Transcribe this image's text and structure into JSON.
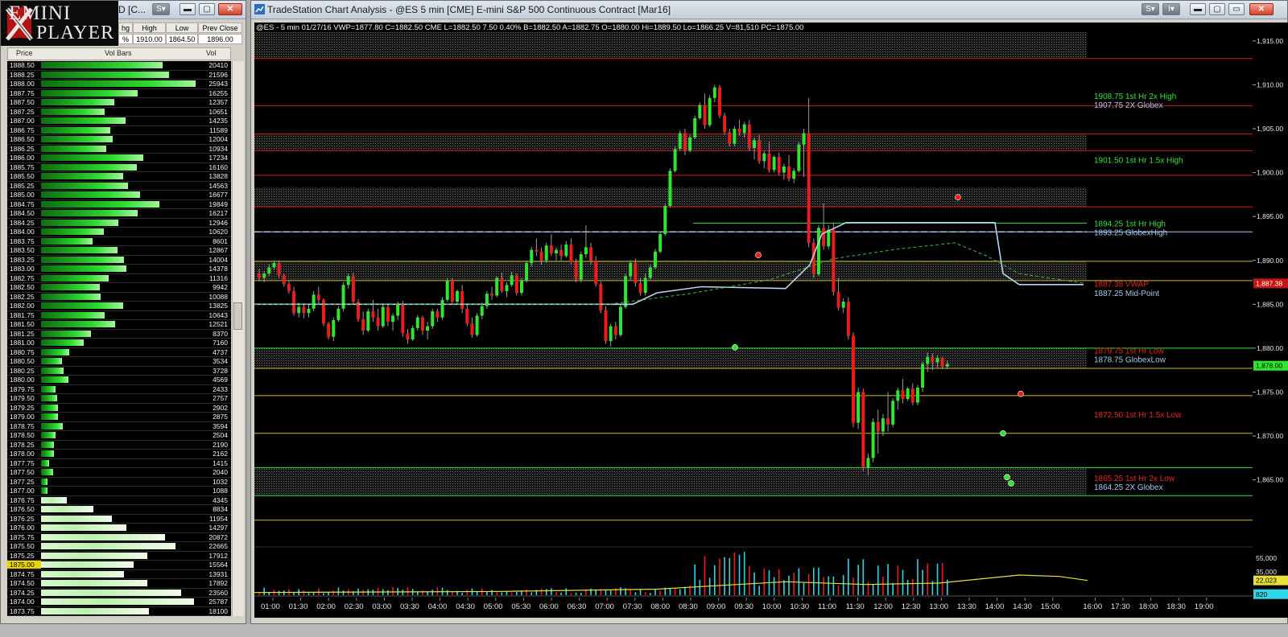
{
  "ladder_window": {
    "title": "D [C...",
    "logo_line1": "EMINI",
    "logo_line2": "PLAYER",
    "quote_headers": [
      "hg",
      "High",
      "Low",
      "Prev Close"
    ],
    "quote_values": [
      "%",
      "1910.00",
      "1864.50",
      "1896.00"
    ],
    "col_price": "Price",
    "col_volbars": "Vol Bars",
    "col_vol": "Vol",
    "current_price": "1875.00",
    "rows": [
      [
        "1888.50",
        "20410"
      ],
      [
        "1888.25",
        "21596"
      ],
      [
        "1888.00",
        "25943"
      ],
      [
        "1887.75",
        "16255"
      ],
      [
        "1887.50",
        "12357"
      ],
      [
        "1887.25",
        "10651"
      ],
      [
        "1887.00",
        "14235"
      ],
      [
        "1886.75",
        "11589"
      ],
      [
        "1886.50",
        "12004"
      ],
      [
        "1886.25",
        "10934"
      ],
      [
        "1886.00",
        "17234"
      ],
      [
        "1885.75",
        "16160"
      ],
      [
        "1885.50",
        "13828"
      ],
      [
        "1885.25",
        "14563"
      ],
      [
        "1885.00",
        "16677"
      ],
      [
        "1884.75",
        "19849"
      ],
      [
        "1884.50",
        "16217"
      ],
      [
        "1884.25",
        "12946"
      ],
      [
        "1884.00",
        "10620"
      ],
      [
        "1883.75",
        "8601"
      ],
      [
        "1883.50",
        "12867"
      ],
      [
        "1883.25",
        "14004"
      ],
      [
        "1883.00",
        "14378"
      ],
      [
        "1882.75",
        "11316"
      ],
      [
        "1882.50",
        "9942"
      ],
      [
        "1882.25",
        "10088"
      ],
      [
        "1882.00",
        "13825"
      ],
      [
        "1881.75",
        "10643"
      ],
      [
        "1881.50",
        "12521"
      ],
      [
        "1881.25",
        "8370"
      ],
      [
        "1881.00",
        "7160"
      ],
      [
        "1880.75",
        "4737"
      ],
      [
        "1880.50",
        "3534"
      ],
      [
        "1880.25",
        "3728"
      ],
      [
        "1880.00",
        "4569"
      ],
      [
        "1879.75",
        "2433"
      ],
      [
        "1879.50",
        "2757"
      ],
      [
        "1879.25",
        "2902"
      ],
      [
        "1879.00",
        "2875"
      ],
      [
        "1878.75",
        "3594"
      ],
      [
        "1878.50",
        "2504"
      ],
      [
        "1878.25",
        "2190"
      ],
      [
        "1878.00",
        "2162"
      ],
      [
        "1877.75",
        "1415"
      ],
      [
        "1877.50",
        "2040"
      ],
      [
        "1877.25",
        "1032"
      ],
      [
        "1877.00",
        "1088"
      ],
      [
        "1876.75",
        "4345"
      ],
      [
        "1876.50",
        "8834"
      ],
      [
        "1876.25",
        "11954"
      ],
      [
        "1876.00",
        "14297"
      ],
      [
        "1875.75",
        "20872"
      ],
      [
        "1875.50",
        "22665"
      ],
      [
        "1875.25",
        "17912"
      ],
      [
        "1875.00",
        "15564"
      ],
      [
        "1874.75",
        "13931"
      ],
      [
        "1874.50",
        "17892"
      ],
      [
        "1874.25",
        "23560"
      ],
      [
        "1874.00",
        "25787"
      ],
      [
        "1873.75",
        "18100"
      ]
    ]
  },
  "chart_window": {
    "title": "TradeStation Chart Analysis - @ES 5 min [CME] E-mini S&P 500 Continuous Contract [Mar16]",
    "infobar": "@ES - 5 min  01/27/16  VWP=1877.80  C=1882.50  CME  L=1882.50  7.50  0.40%  B=1882.50  A=1882.75  O=1880.00  Hi=1889.50  Lo=1866.25  V=81,510  PC=1875.00",
    "last_price_tag": "1,878.00",
    "vwap_tag": "1,887.38",
    "vol_tag_ma": "22,023",
    "vol_tag_last": "820",
    "level_labels": [
      {
        "text": "1908.75 1st Hr  2x High",
        "color": "#37e23c"
      },
      {
        "text": "1907.75 2X Globex",
        "color": "#a9c8ee"
      },
      {
        "text": "1901.50 1st Hr  1.5x High",
        "color": "#37e23c"
      },
      {
        "text": "1894.25 1st Hr  High",
        "color": "#37e23c"
      },
      {
        "text": "1893.25 GlobexHigh",
        "color": "#a9c8ee"
      },
      {
        "text": "1887.38 VWAP",
        "color": "#e8251c"
      },
      {
        "text": "1887.25 Mid-Point",
        "color": "#a9c8ee"
      },
      {
        "text": "1879.75 1st Hr  Low",
        "color": "#e8251c"
      },
      {
        "text": "1878.75 GlobexLow",
        "color": "#a9c8ee"
      },
      {
        "text": "1872.50 1st Hr  1.5x Low",
        "color": "#e8251c"
      },
      {
        "text": "1865.25 1st Hr  2x Low",
        "color": "#e8251c"
      },
      {
        "text": "1864.25 2X Globex",
        "color": "#a9c8ee"
      }
    ]
  },
  "chart_data": {
    "type": "candlestick",
    "title": "@ES - 5 min",
    "ylim": [
      1858,
      1916
    ],
    "y_ticks": [
      "1,915.00",
      "1,910.00",
      "1,905.00",
      "1,900.00",
      "1,895.00",
      "1,890.00",
      "1,885.00",
      "1,880.00",
      "1,875.00",
      "1,870.00",
      "1,865.00"
    ],
    "y_tick_values": [
      1915,
      1910,
      1905,
      1900,
      1895,
      1890,
      1885,
      1880,
      1875,
      1870,
      1865
    ],
    "x_ticks": [
      "01:00",
      "01:30",
      "02:00",
      "02:30",
      "03:00",
      "03:30",
      "04:00",
      "04:30",
      "05:00",
      "05:30",
      "06:00",
      "06:30",
      "07:00",
      "07:30",
      "08:00",
      "08:30",
      "09:00",
      "09:30",
      "10:00",
      "10:30",
      "11:00",
      "11:30",
      "12:00",
      "12:30",
      "13:00",
      "13:30",
      "14:00",
      "14:30",
      "15:00",
      "16:00",
      "17:30",
      "18:00",
      "18:30",
      "19:00"
    ],
    "volume_ticks": [
      "55,000",
      "35,000"
    ],
    "volume_tick_values": [
      55000,
      35000
    ],
    "horizontal_levels": [
      {
        "y": 1913.0,
        "color": "#d01a1a"
      },
      {
        "y": 1907.6,
        "color": "#d01a1a"
      },
      {
        "y": 1904.4,
        "color": "#d01a1a"
      },
      {
        "y": 1902.5,
        "color": "#d01a1a"
      },
      {
        "y": 1899.7,
        "color": "#d01a1a"
      },
      {
        "y": 1896.1,
        "color": "#d01a1a"
      },
      {
        "y": 1894.25,
        "color": "#37e23c"
      },
      {
        "y": 1893.25,
        "color": "#a9c8ee"
      },
      {
        "y": 1889.9,
        "color": "#c8b92a"
      },
      {
        "y": 1887.7,
        "color": "#c8b92a"
      },
      {
        "y": 1880.0,
        "color": "#37e23c"
      },
      {
        "y": 1877.7,
        "color": "#c8b92a"
      },
      {
        "y": 1874.6,
        "color": "#c8b92a"
      },
      {
        "y": 1870.3,
        "color": "#c8b92a"
      },
      {
        "y": 1866.4,
        "color": "#37e23c"
      },
      {
        "y": 1863.2,
        "color": "#37e23c"
      },
      {
        "y": 1860.4,
        "color": "#c8b92a"
      }
    ],
    "shaded_zones": [
      [
        1913.0,
        1916.0
      ],
      [
        1902.5,
        1904.4
      ],
      [
        1896.1,
        1898.3
      ],
      [
        1887.7,
        1889.9
      ],
      [
        1877.7,
        1880.0
      ],
      [
        1863.2,
        1866.4
      ]
    ],
    "candles": [
      [
        1888.5,
        1889.0,
        1887.6,
        1888.0
      ],
      [
        1888.0,
        1888.8,
        1887.5,
        1888.5
      ],
      [
        1888.5,
        1889.6,
        1888.2,
        1889.2
      ],
      [
        1889.2,
        1890.0,
        1888.9,
        1889.7
      ],
      [
        1889.7,
        1890.0,
        1888.0,
        1888.3
      ],
      [
        1888.3,
        1888.5,
        1887.0,
        1887.3
      ],
      [
        1887.3,
        1887.7,
        1886.2,
        1886.5
      ],
      [
        1886.5,
        1887.0,
        1883.7,
        1884.0
      ],
      [
        1884.0,
        1885.2,
        1883.5,
        1884.7
      ],
      [
        1884.7,
        1885.0,
        1883.4,
        1884.0
      ],
      [
        1884.0,
        1885.0,
        1883.5,
        1884.5
      ],
      [
        1884.5,
        1886.5,
        1884.2,
        1886.1
      ],
      [
        1886.1,
        1887.0,
        1885.0,
        1885.5
      ],
      [
        1885.5,
        1885.7,
        1882.5,
        1882.8
      ],
      [
        1882.8,
        1883.0,
        1881.0,
        1881.3
      ],
      [
        1881.3,
        1883.5,
        1880.8,
        1883.2
      ],
      [
        1883.2,
        1884.8,
        1883.0,
        1884.5
      ],
      [
        1884.5,
        1887.5,
        1884.2,
        1887.2
      ],
      [
        1887.2,
        1888.5,
        1886.8,
        1888.2
      ],
      [
        1888.2,
        1888.6,
        1885.0,
        1885.3
      ],
      [
        1885.3,
        1885.6,
        1883.0,
        1883.3
      ],
      [
        1883.3,
        1884.2,
        1881.5,
        1882.0
      ],
      [
        1882.0,
        1884.5,
        1881.8,
        1884.2
      ],
      [
        1884.2,
        1885.5,
        1883.0,
        1883.5
      ],
      [
        1883.5,
        1884.5,
        1882.0,
        1882.5
      ],
      [
        1882.5,
        1885.0,
        1882.3,
        1884.7
      ],
      [
        1884.7,
        1885.0,
        1882.5,
        1883.0
      ],
      [
        1883.0,
        1884.0,
        1882.0,
        1883.7
      ],
      [
        1883.7,
        1885.3,
        1883.2,
        1885.0
      ],
      [
        1885.0,
        1885.4,
        1881.3,
        1881.7
      ],
      [
        1881.7,
        1882.2,
        1880.5,
        1881.0
      ],
      [
        1881.0,
        1882.6,
        1880.8,
        1882.3
      ],
      [
        1882.3,
        1883.8,
        1882.0,
        1883.5
      ],
      [
        1883.5,
        1883.7,
        1881.5,
        1882.0
      ],
      [
        1882.0,
        1883.0,
        1881.0,
        1882.5
      ],
      [
        1882.5,
        1884.5,
        1882.2,
        1884.2
      ],
      [
        1884.2,
        1884.5,
        1883.0,
        1883.5
      ],
      [
        1883.5,
        1885.8,
        1883.2,
        1885.5
      ],
      [
        1885.5,
        1888.0,
        1885.3,
        1887.7
      ],
      [
        1887.7,
        1888.0,
        1885.0,
        1885.3
      ],
      [
        1885.3,
        1886.7,
        1885.0,
        1886.5
      ],
      [
        1886.5,
        1887.2,
        1884.0,
        1884.5
      ],
      [
        1884.5,
        1885.0,
        1882.5,
        1882.8
      ],
      [
        1882.8,
        1883.5,
        1881.2,
        1881.5
      ],
      [
        1881.5,
        1884.0,
        1881.3,
        1883.7
      ],
      [
        1883.7,
        1885.2,
        1883.3,
        1884.8
      ],
      [
        1884.8,
        1886.5,
        1884.5,
        1886.2
      ],
      [
        1886.2,
        1887.0,
        1885.5,
        1886.0
      ],
      [
        1886.0,
        1888.2,
        1885.8,
        1888.0
      ],
      [
        1888.0,
        1888.6,
        1886.3,
        1886.5
      ],
      [
        1886.5,
        1887.5,
        1885.8,
        1887.2
      ],
      [
        1887.2,
        1888.7,
        1887.0,
        1888.3
      ],
      [
        1888.3,
        1888.5,
        1886.0,
        1886.3
      ],
      [
        1886.3,
        1888.0,
        1886.0,
        1887.7
      ],
      [
        1887.7,
        1890.0,
        1887.5,
        1889.7
      ],
      [
        1889.7,
        1891.5,
        1889.3,
        1891.2
      ],
      [
        1891.2,
        1892.5,
        1890.5,
        1891.0
      ],
      [
        1891.0,
        1891.5,
        1889.5,
        1890.0
      ],
      [
        1890.0,
        1892.0,
        1889.7,
        1891.7
      ],
      [
        1891.7,
        1893.0,
        1890.5,
        1890.8
      ],
      [
        1890.8,
        1891.5,
        1890.0,
        1891.2
      ],
      [
        1891.2,
        1891.8,
        1890.0,
        1890.5
      ],
      [
        1890.5,
        1892.2,
        1890.3,
        1891.8
      ],
      [
        1891.8,
        1892.5,
        1889.5,
        1889.8
      ],
      [
        1889.8,
        1890.2,
        1887.5,
        1887.8
      ],
      [
        1887.8,
        1891.0,
        1887.5,
        1890.7
      ],
      [
        1890.7,
        1894.0,
        1890.3,
        1891.5
      ],
      [
        1891.5,
        1892.0,
        1889.5,
        1890.0
      ],
      [
        1890.0,
        1890.5,
        1887.0,
        1887.3
      ],
      [
        1887.3,
        1887.6,
        1884.0,
        1884.3
      ],
      [
        1884.3,
        1884.8,
        1880.5,
        1880.8
      ],
      [
        1880.8,
        1882.8,
        1880.2,
        1882.5
      ],
      [
        1882.5,
        1883.0,
        1881.0,
        1881.5
      ],
      [
        1881.5,
        1885.0,
        1881.3,
        1884.7
      ],
      [
        1884.7,
        1888.5,
        1884.5,
        1888.2
      ],
      [
        1888.2,
        1890.0,
        1887.8,
        1889.7
      ],
      [
        1889.7,
        1890.2,
        1887.0,
        1887.4
      ],
      [
        1887.4,
        1888.0,
        1886.0,
        1886.3
      ],
      [
        1886.3,
        1888.5,
        1886.0,
        1888.0
      ],
      [
        1888.0,
        1889.5,
        1887.8,
        1889.2
      ],
      [
        1889.2,
        1891.3,
        1889.0,
        1891.0
      ],
      [
        1891.0,
        1893.2,
        1890.8,
        1893.0
      ],
      [
        1893.0,
        1896.5,
        1892.8,
        1896.2
      ],
      [
        1896.2,
        1900.5,
        1896.0,
        1900.2
      ],
      [
        1900.2,
        1903.0,
        1900.0,
        1902.7
      ],
      [
        1902.7,
        1904.8,
        1902.5,
        1904.5
      ],
      [
        1904.5,
        1905.0,
        1902.0,
        1902.5
      ],
      [
        1902.5,
        1904.3,
        1902.3,
        1904.0
      ],
      [
        1904.0,
        1906.5,
        1903.8,
        1906.2
      ],
      [
        1906.2,
        1908.0,
        1906.0,
        1907.7
      ],
      [
        1907.7,
        1909.0,
        1905.0,
        1905.4
      ],
      [
        1905.4,
        1908.8,
        1905.2,
        1908.5
      ],
      [
        1908.5,
        1910.0,
        1908.0,
        1909.7
      ],
      [
        1909.7,
        1910.0,
        1906.2,
        1906.5
      ],
      [
        1906.5,
        1906.8,
        1904.3,
        1904.6
      ],
      [
        1904.6,
        1905.0,
        1903.0,
        1903.3
      ],
      [
        1903.3,
        1905.3,
        1903.0,
        1905.0
      ],
      [
        1905.0,
        1906.0,
        1904.2,
        1904.5
      ],
      [
        1904.5,
        1905.8,
        1904.0,
        1905.5
      ],
      [
        1905.5,
        1906.0,
        1902.5,
        1902.8
      ],
      [
        1902.8,
        1904.0,
        1901.5,
        1903.7
      ],
      [
        1903.7,
        1904.3,
        1901.0,
        1901.3
      ],
      [
        1901.3,
        1902.5,
        1900.5,
        1902.2
      ],
      [
        1902.2,
        1903.5,
        1900.0,
        1900.3
      ],
      [
        1900.3,
        1902.0,
        1900.0,
        1901.8
      ],
      [
        1901.8,
        1902.3,
        1899.7,
        1900.0
      ],
      [
        1900.0,
        1901.0,
        1899.2,
        1900.7
      ],
      [
        1900.7,
        1902.0,
        1899.0,
        1899.3
      ],
      [
        1899.3,
        1900.5,
        1898.8,
        1900.2
      ],
      [
        1900.2,
        1903.5,
        1900.0,
        1903.2
      ],
      [
        1903.2,
        1905.0,
        1899.5,
        1904.5
      ],
      [
        1904.5,
        1908.5,
        1891.5,
        1892.0
      ],
      [
        1892.0,
        1892.5,
        1888.0,
        1888.4
      ],
      [
        1888.4,
        1894.0,
        1888.2,
        1893.7
      ],
      [
        1893.7,
        1896.5,
        1891.2,
        1891.6
      ],
      [
        1891.6,
        1894.0,
        1891.3,
        1893.5
      ],
      [
        1893.5,
        1894.3,
        1886.0,
        1886.4
      ],
      [
        1886.4,
        1888.0,
        1884.3,
        1884.6
      ],
      [
        1884.6,
        1885.7,
        1884.0,
        1885.3
      ],
      [
        1885.3,
        1885.8,
        1881.0,
        1881.4
      ],
      [
        1881.4,
        1881.8,
        1871.0,
        1871.5
      ],
      [
        1871.5,
        1875.5,
        1870.8,
        1875.0
      ],
      [
        1875.0,
        1875.4,
        1866.0,
        1866.4
      ],
      [
        1866.4,
        1868.0,
        1865.5,
        1867.5
      ],
      [
        1867.5,
        1872.0,
        1867.0,
        1871.6
      ],
      [
        1871.6,
        1873.0,
        1868.0,
        1870.5
      ],
      [
        1870.5,
        1872.5,
        1870.0,
        1872.0
      ],
      [
        1872.0,
        1875.0,
        1870.5,
        1871.3
      ],
      [
        1871.3,
        1874.3,
        1871.0,
        1874.0
      ],
      [
        1874.0,
        1875.5,
        1873.0,
        1875.2
      ],
      [
        1875.2,
        1876.5,
        1873.7,
        1874.2
      ],
      [
        1874.2,
        1875.6,
        1874.0,
        1875.4
      ],
      [
        1875.4,
        1876.0,
        1873.5,
        1873.8
      ],
      [
        1873.8,
        1875.8,
        1873.5,
        1875.5
      ],
      [
        1875.5,
        1878.5,
        1875.0,
        1878.2
      ],
      [
        1878.2,
        1879.5,
        1877.3,
        1879.0
      ],
      [
        1879.0,
        1879.4,
        1877.5,
        1878.4
      ],
      [
        1878.4,
        1879.2,
        1877.8,
        1878.9
      ],
      [
        1878.9,
        1879.0,
        1877.6,
        1877.9
      ],
      [
        1877.9,
        1878.6,
        1877.6,
        1878.2
      ]
    ]
  }
}
